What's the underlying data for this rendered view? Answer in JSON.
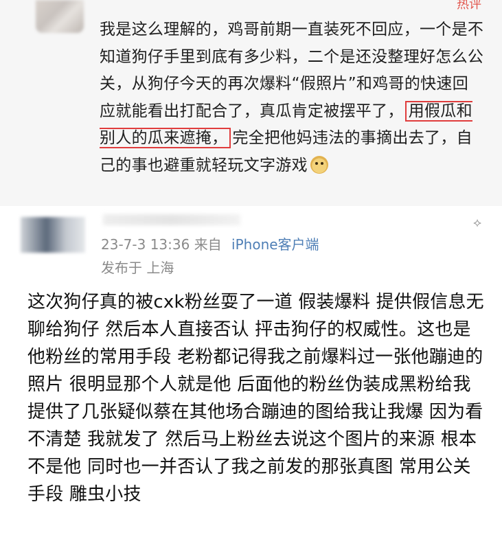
{
  "comment1": {
    "hot_label": "热评",
    "text_before": "我是这么理解的，鸡哥前期一直装死不回应，一个是不知道狗仔手里到底有多少料，二个是还没整理好怎么公关，从狗仔今天的再次爆料“假照片”和鸡哥的快速回应就能看出打配合了，真瓜肯定被摆平了，",
    "text_highlight": "用假瓜和别人的瓜来遮掩，",
    "text_after": "完全把他妈违法的事摘出去了，自己的事也避重就轻玩文字游戏",
    "emoji": "doge-emoji"
  },
  "comment2": {
    "timestamp": "23-7-3 13:36",
    "from_label": "来自",
    "source": "iPhone客户端",
    "location": "发布于 上海",
    "body": "这次狗仔真的被cxk粉丝耍了一道 假装爆料 提供假信息无聊给狗仔 然后本人直接否认 抨击狗仔的权威性。这也是他粉丝的常用手段 老粉都记得我之前爆料过一张他蹦迪的照片 很明显那个人就是他 后面他的粉丝伪装成黑粉给我提供了几张疑似蔡在其他场合蹦迪的图给我让我爆 因为看不清楚 我就发了 然后马上粉丝去说这个图片的来源 根本不是他 同时也一并否认了我之前发的那张真图 常用公关手段 雕虫小技"
  },
  "colors": {
    "highlight_border": "#e03c3c",
    "source_link": "#4f7fb6",
    "meta_text": "#8a8a8a"
  }
}
